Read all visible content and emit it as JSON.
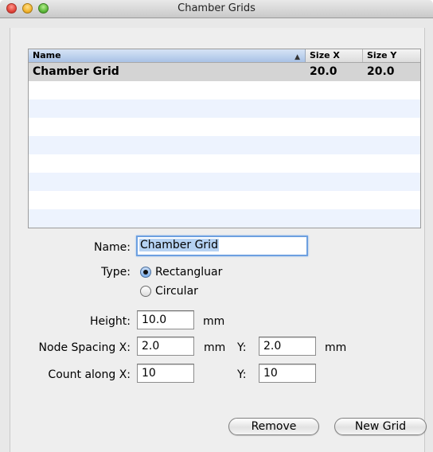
{
  "window": {
    "title": "Chamber Grids"
  },
  "table": {
    "columns": {
      "name": "Name",
      "size_x": "Size X",
      "size_y": "Size Y"
    },
    "sort_indicator": "▲",
    "rows": [
      {
        "name": "Chamber Grid",
        "size_x": "20.0",
        "size_y": "20.0"
      }
    ]
  },
  "form": {
    "name_label": "Name:",
    "name_value": "Chamber Grid",
    "type_label": "Type:",
    "type_options": [
      {
        "label": "Rectangluar",
        "selected": true
      },
      {
        "label": "Circular",
        "selected": false
      }
    ],
    "height_label": "Height:",
    "height_value": "10.0",
    "height_unit": "mm",
    "spacing_label": "Node Spacing  X:",
    "spacing_x_value": "2.0",
    "spacing_x_unit": "mm",
    "spacing_y_label": "Y:",
    "spacing_y_value": "2.0",
    "spacing_y_unit": "mm",
    "count_label": "Count along  X:",
    "count_x_value": "10",
    "count_y_label": "Y:",
    "count_y_value": "10"
  },
  "buttons": {
    "remove": "Remove",
    "new_grid": "New Grid"
  }
}
